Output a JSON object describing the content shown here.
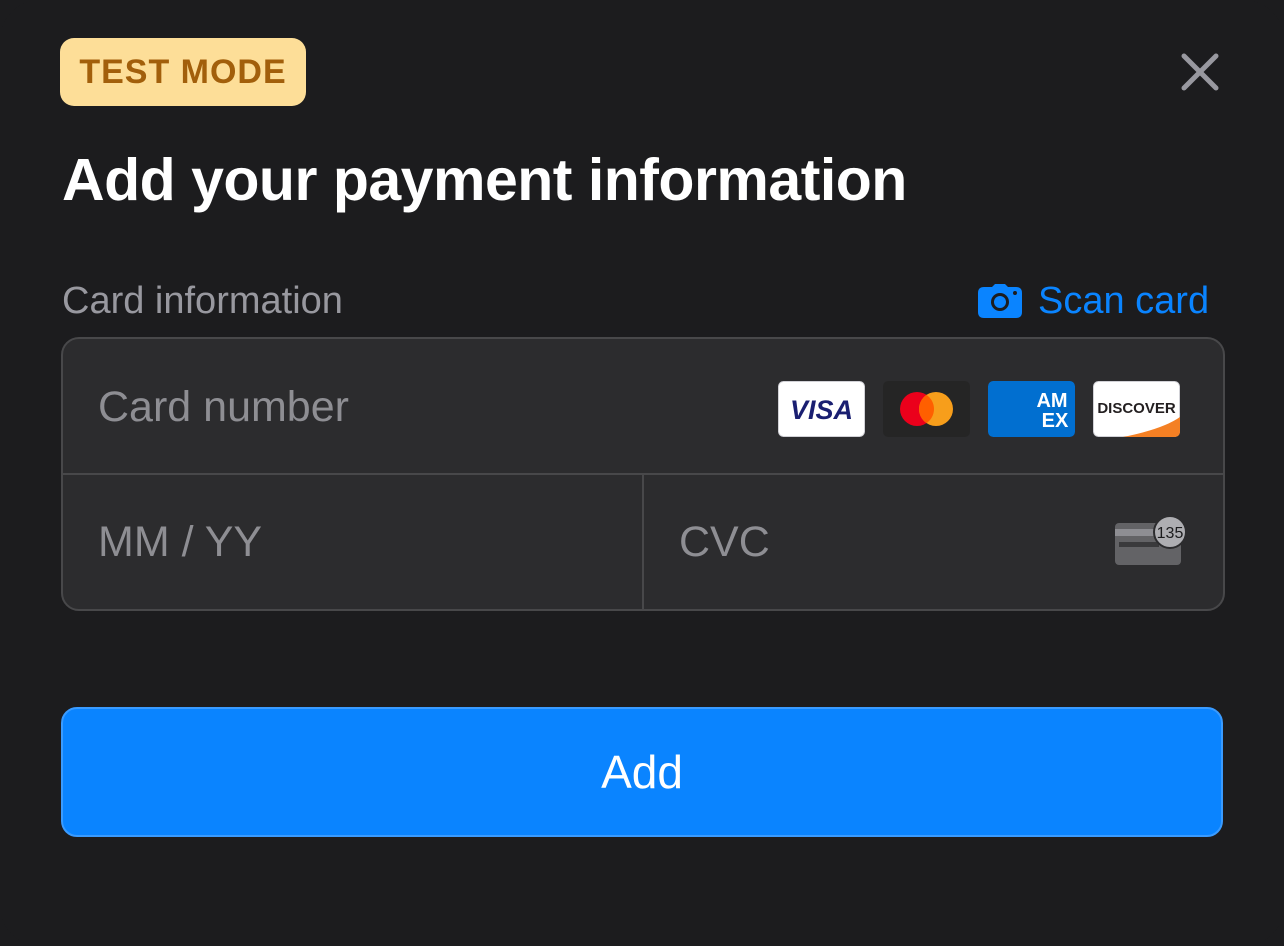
{
  "badge": {
    "label": "TEST MODE"
  },
  "close": {
    "icon": "close-icon"
  },
  "title": "Add your payment information",
  "card_section": {
    "label": "Card information",
    "scan": {
      "label": "Scan card",
      "icon": "camera-icon"
    }
  },
  "fields": {
    "card_number": {
      "placeholder": "Card number",
      "value": ""
    },
    "expiry": {
      "placeholder": "MM / YY",
      "value": ""
    },
    "cvc": {
      "placeholder": "CVC",
      "value": "",
      "hint_number": "135"
    }
  },
  "brands": [
    {
      "name": "visa-logo",
      "text": "VISA"
    },
    {
      "name": "mastercard-logo",
      "text": ""
    },
    {
      "name": "amex-logo",
      "text": "AM EX"
    },
    {
      "name": "discover-logo",
      "text": "DISCOVER"
    }
  ],
  "submit": {
    "label": "Add"
  },
  "colors": {
    "background": "#1c1c1e",
    "field_background": "#2c2c2e",
    "accent": "#0a84ff",
    "badge_background": "#fdde98",
    "badge_text": "#a25f0b"
  }
}
